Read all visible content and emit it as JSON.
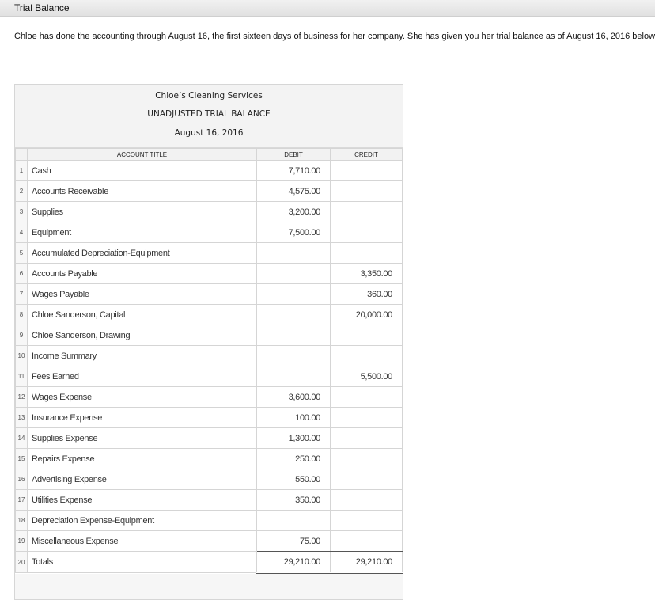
{
  "window": {
    "title": "Trial Balance"
  },
  "intro": "Chloe has done the accounting through August 16, the first sixteen days of business for her company. She has given you her trial balance as of August 16, 2016 below.",
  "report": {
    "company": "Chloe’s Cleaning Services",
    "title": "UNADJUSTED TRIAL BALANCE",
    "date": "August 16, 2016"
  },
  "columns": {
    "account": "ACCOUNT TITLE",
    "debit": "DEBIT",
    "credit": "CREDIT"
  },
  "rows": [
    {
      "num": "1",
      "account": "Cash",
      "debit": "7,710.00",
      "credit": ""
    },
    {
      "num": "2",
      "account": "Accounts Receivable",
      "debit": "4,575.00",
      "credit": ""
    },
    {
      "num": "3",
      "account": "Supplies",
      "debit": "3,200.00",
      "credit": ""
    },
    {
      "num": "4",
      "account": "Equipment",
      "debit": "7,500.00",
      "credit": ""
    },
    {
      "num": "5",
      "account": "Accumulated Depreciation-Equipment",
      "debit": "",
      "credit": ""
    },
    {
      "num": "6",
      "account": "Accounts Payable",
      "debit": "",
      "credit": "3,350.00"
    },
    {
      "num": "7",
      "account": "Wages Payable",
      "debit": "",
      "credit": "360.00"
    },
    {
      "num": "8",
      "account": "Chloe Sanderson, Capital",
      "debit": "",
      "credit": "20,000.00"
    },
    {
      "num": "9",
      "account": "Chloe Sanderson, Drawing",
      "debit": "",
      "credit": ""
    },
    {
      "num": "10",
      "account": "Income Summary",
      "debit": "",
      "credit": ""
    },
    {
      "num": "11",
      "account": "Fees Earned",
      "debit": "",
      "credit": "5,500.00"
    },
    {
      "num": "12",
      "account": "Wages Expense",
      "debit": "3,600.00",
      "credit": ""
    },
    {
      "num": "13",
      "account": "Insurance Expense",
      "debit": "100.00",
      "credit": ""
    },
    {
      "num": "14",
      "account": "Supplies Expense",
      "debit": "1,300.00",
      "credit": ""
    },
    {
      "num": "15",
      "account": "Repairs Expense",
      "debit": "250.00",
      "credit": ""
    },
    {
      "num": "16",
      "account": "Advertising Expense",
      "debit": "550.00",
      "credit": ""
    },
    {
      "num": "17",
      "account": "Utilities Expense",
      "debit": "350.00",
      "credit": ""
    },
    {
      "num": "18",
      "account": "Depreciation Expense-Equipment",
      "debit": "",
      "credit": ""
    },
    {
      "num": "19",
      "account": "Miscellaneous Expense",
      "debit": "75.00",
      "credit": ""
    },
    {
      "num": "20",
      "account": "Totals",
      "debit": "29,210.00",
      "credit": "29,210.00"
    }
  ]
}
